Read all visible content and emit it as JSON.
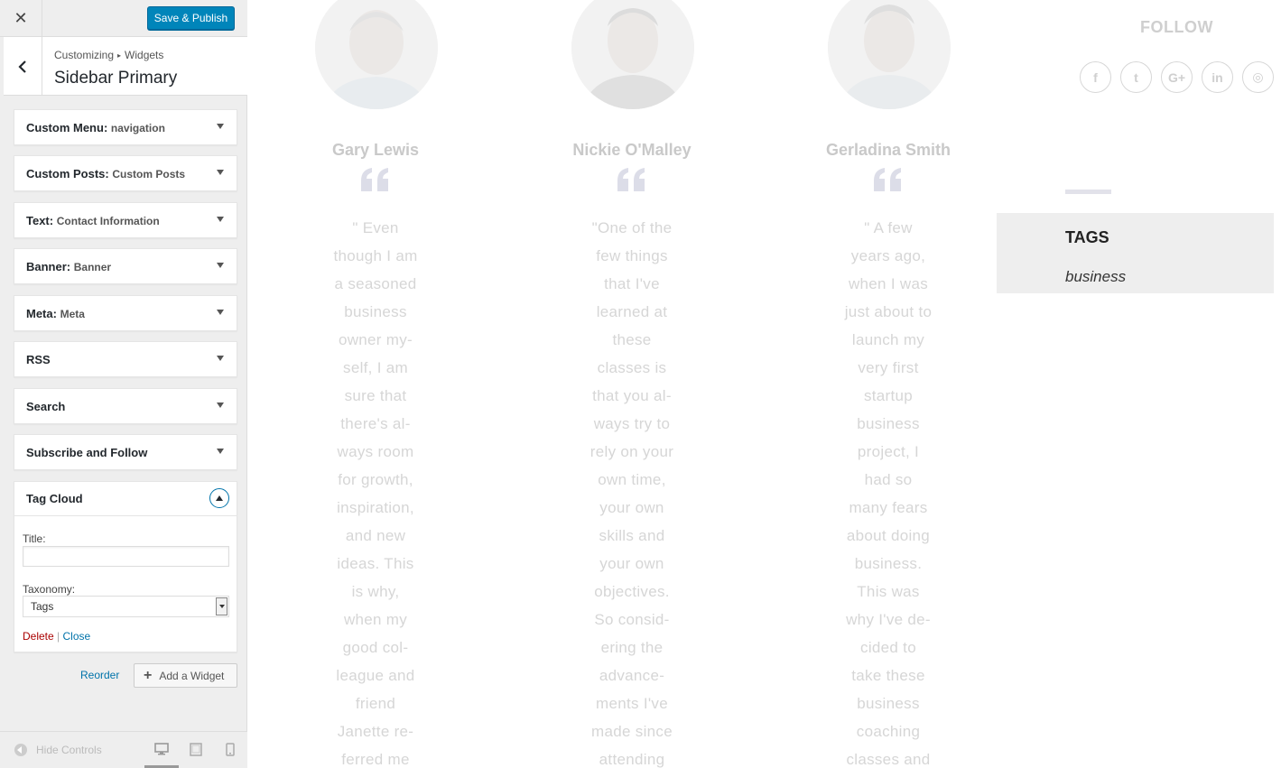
{
  "customizer": {
    "close_icon": "close-icon",
    "publish_label": "Save & Publish",
    "breadcrumb": {
      "root": "Customizing",
      "separator": "▸",
      "current": "Widgets"
    },
    "section_title": "Sidebar Primary",
    "widgets": [
      {
        "type": "Custom Menu",
        "instance": "navigation"
      },
      {
        "type": "Custom Posts",
        "instance": "Custom Posts"
      },
      {
        "type": "Text",
        "instance": "Contact Information"
      },
      {
        "type": "Banner",
        "instance": "Banner"
      },
      {
        "type": "Meta",
        "instance": "Meta"
      },
      {
        "type": "RSS",
        "instance": ""
      },
      {
        "type": "Search",
        "instance": ""
      },
      {
        "type": "Subscribe and Follow",
        "instance": ""
      }
    ],
    "open_widget": {
      "title": "Tag Cloud",
      "title_label": "Title:",
      "title_value": "",
      "taxonomy_label": "Taxonomy:",
      "taxonomy_value": "Tags",
      "delete_label": "Delete",
      "link_separator": "|",
      "close_label": "Close"
    },
    "reorder_label": "Reorder",
    "add_widget_label": "Add a Widget",
    "hide_controls_label": "Hide Controls",
    "colors": {
      "primary": "#0085ba",
      "link": "#0073aa",
      "delete": "#aa0000"
    }
  },
  "preview": {
    "testimonials": [
      {
        "name": "Gary Lewis",
        "quote_lines": [
          "\" Even",
          "though I am",
          "a seasoned",
          "business",
          "owner my-",
          "self, I am",
          "sure that",
          "there's al-",
          "ways room",
          "for growth,",
          "inspiration,",
          "and new",
          "ideas. This",
          "is why,",
          "when my",
          "good col-",
          "league and",
          "friend",
          "Janette re-",
          "ferred me"
        ]
      },
      {
        "name": "Nickie O'Malley",
        "quote_lines": [
          "\"One of the",
          "few things",
          "that I've",
          "learned at",
          "these",
          "classes is",
          "that you al-",
          "ways try to",
          "rely on your",
          "own time,",
          "your own",
          "skills and",
          "your own",
          "objectives.",
          "So consid-",
          "ering the",
          "advance-",
          "ments I've",
          "made since",
          "attending"
        ]
      },
      {
        "name": "Gerladina Smith",
        "quote_lines": [
          "\" A few",
          "years ago,",
          "when I was",
          "just about to",
          "launch my",
          "very first",
          "startup",
          "business",
          "project, I",
          "had so",
          "many fears",
          "about doing",
          "business.",
          "This was",
          "why I've de-",
          "cided to",
          "take these",
          "business",
          "coaching",
          "classes and"
        ]
      }
    ],
    "follow_title": "FOLLOW",
    "social_icons": [
      {
        "icon": "facebook-icon",
        "glyph": "f"
      },
      {
        "icon": "twitter-icon",
        "glyph": "t"
      },
      {
        "icon": "google-plus-icon",
        "glyph": "G+"
      },
      {
        "icon": "linkedin-icon",
        "glyph": "in"
      },
      {
        "icon": "instagram-icon",
        "glyph": "◎"
      }
    ],
    "tags_title": "TAGS",
    "tags": [
      "business"
    ]
  }
}
